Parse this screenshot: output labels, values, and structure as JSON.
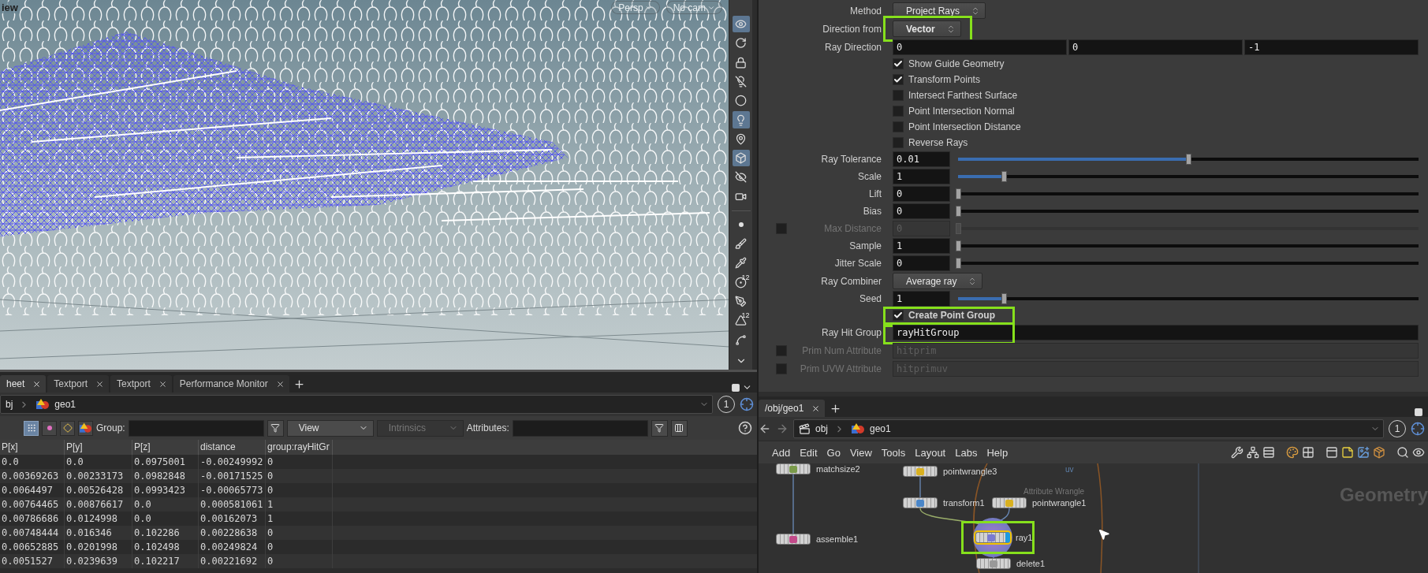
{
  "viewport": {
    "title": "iew",
    "camera_menus": [
      "Persp",
      "No cam"
    ],
    "tools": [
      {
        "on": true
      },
      {
        "on": false
      },
      {
        "on": false
      },
      {
        "on": false
      },
      {
        "on": false
      },
      {
        "on": true
      },
      {
        "on": false
      },
      {
        "on": true
      },
      {
        "on": false
      },
      {
        "on": false
      },
      {
        "on": false
      },
      {
        "on": false
      },
      {
        "on": false
      },
      {
        "on": false,
        "label": "12"
      },
      {
        "on": false
      },
      {
        "on": false,
        "label": "12"
      },
      {
        "on": false
      }
    ]
  },
  "spreadsheet": {
    "tabs": [
      {
        "label": "heet",
        "selected": true
      },
      {
        "label": "Textport",
        "selected": false
      },
      {
        "label": "Textport",
        "selected": false
      },
      {
        "label": "Performance Monitor",
        "selected": false
      }
    ],
    "path": [
      "bj",
      "geo1"
    ],
    "pin": "1",
    "components": [
      {
        "selected": true
      },
      {
        "selected": false
      },
      {
        "selected": false
      },
      {
        "selected": false
      }
    ],
    "group_label": "Group:",
    "menus": [
      {
        "label": "View",
        "disabled": false
      },
      {
        "label": "Intrinsics",
        "disabled": true
      }
    ],
    "attributes_label": "Attributes:",
    "columns": [
      "P[x]",
      "P[y]",
      "P[z]",
      "distance",
      "group:rayHitGr"
    ],
    "rows": [
      [
        "0.0",
        "0.0",
        "0.0975001",
        "-0.00249992",
        "0"
      ],
      [
        "0.00369263",
        "0.00233173",
        "0.0982848",
        "-0.00171525",
        "0"
      ],
      [
        "0.0064497",
        "0.00526428",
        "0.0993423",
        "-0.00065773",
        "0"
      ],
      [
        "0.00764465",
        "0.00876617",
        "0.0",
        "0.000581061",
        "1"
      ],
      [
        "0.00786686",
        "0.0124998",
        "0.0",
        "0.00162073",
        "1"
      ],
      [
        "0.00748444",
        "0.016346",
        "0.102286",
        "0.00228638",
        "0"
      ],
      [
        "0.00652885",
        "0.0201998",
        "0.102498",
        "0.00249824",
        "0"
      ],
      [
        "0.0051527",
        "0.0239639",
        "0.102217",
        "0.00221692",
        "0"
      ]
    ]
  },
  "parameters": {
    "rows": [
      {
        "kind": "menu",
        "label": "Method",
        "value": "Project Rays",
        "modified": false
      },
      {
        "kind": "menu",
        "label": "Direction from",
        "value": "Vector",
        "modified": true,
        "highlighted": true
      },
      {
        "kind": "vector",
        "label": "Ray Direction",
        "values": [
          "0",
          "0",
          "-1"
        ]
      },
      {
        "kind": "toggle",
        "label": "Show Guide Geometry",
        "checked": true,
        "modified": false
      },
      {
        "kind": "toggle",
        "label": "Transform Points",
        "checked": true,
        "modified": false
      },
      {
        "kind": "toggle",
        "label": "Intersect Farthest Surface",
        "checked": false,
        "modified": false
      },
      {
        "kind": "toggle",
        "label": "Point Intersection Normal",
        "checked": false,
        "modified": false
      },
      {
        "kind": "toggle",
        "label": "Point Intersection Distance",
        "checked": false,
        "modified": false
      },
      {
        "kind": "toggle",
        "label": "Reverse Rays",
        "checked": false,
        "modified": false
      },
      {
        "kind": "slider",
        "label": "Ray Tolerance",
        "value": "0.01",
        "level": 0.5,
        "disabled": false
      },
      {
        "kind": "slider",
        "label": "Scale",
        "value": "1",
        "level": 0.1,
        "disabled": false
      },
      {
        "kind": "slider",
        "label": "Lift",
        "value": "0",
        "level": 0,
        "disabled": false
      },
      {
        "kind": "slider",
        "label": "Bias",
        "value": "0",
        "level": 0,
        "disabled": false
      },
      {
        "kind": "slider",
        "label": "Max Distance",
        "value": "0",
        "level": 0,
        "disabled": true,
        "toggle_checked": false
      },
      {
        "kind": "slider",
        "label": "Sample",
        "value": "1",
        "level": 0,
        "disabled": false
      },
      {
        "kind": "slider",
        "label": "Jitter Scale",
        "value": "0",
        "level": 0,
        "disabled": false
      },
      {
        "kind": "menu",
        "label": "Ray Combiner",
        "value": "Average ray",
        "modified": false
      },
      {
        "kind": "slider",
        "label": "Seed",
        "value": "1",
        "level": 0.1,
        "disabled": false
      },
      {
        "kind": "toggle",
        "label": "Create Point Group",
        "checked": true,
        "modified": true,
        "highlighted": true
      },
      {
        "kind": "string",
        "label": "Ray Hit Group",
        "value": "rayHitGroup",
        "disabled": false,
        "highlighted": true
      },
      {
        "kind": "string",
        "label": "Prim Num Attribute",
        "value": "hitprim",
        "disabled": true,
        "toggle_checked": false
      },
      {
        "kind": "string",
        "label": "Prim UVW Attribute",
        "value": "hitprimuv",
        "disabled": true,
        "toggle_checked": false
      }
    ]
  },
  "network": {
    "tabs": [
      {
        "label": "/obj/geo1",
        "selected": true
      }
    ],
    "path": [
      "obj",
      "geo1"
    ],
    "pin": "1",
    "menu": [
      "Add",
      "Edit",
      "Go",
      "View",
      "Tools",
      "Layout",
      "Labs",
      "Help"
    ],
    "context_label": "Geometry",
    "wire_label": "uv",
    "nodes": [
      {
        "name": "matchsize2",
        "selected": false,
        "display": false
      },
      {
        "name": "pointwrangle3",
        "selected": false,
        "display": false
      },
      {
        "name": "transform1",
        "selected": false,
        "display": false
      },
      {
        "name": "pointwrangle1",
        "type_label": "Attribute Wrangle",
        "selected": false,
        "display": false
      },
      {
        "name": "assemble1",
        "selected": false,
        "display": false
      },
      {
        "name": "ray1",
        "selected": true,
        "display": true,
        "highlighted": true
      },
      {
        "name": "delete1",
        "selected": false,
        "display": false
      }
    ]
  }
}
